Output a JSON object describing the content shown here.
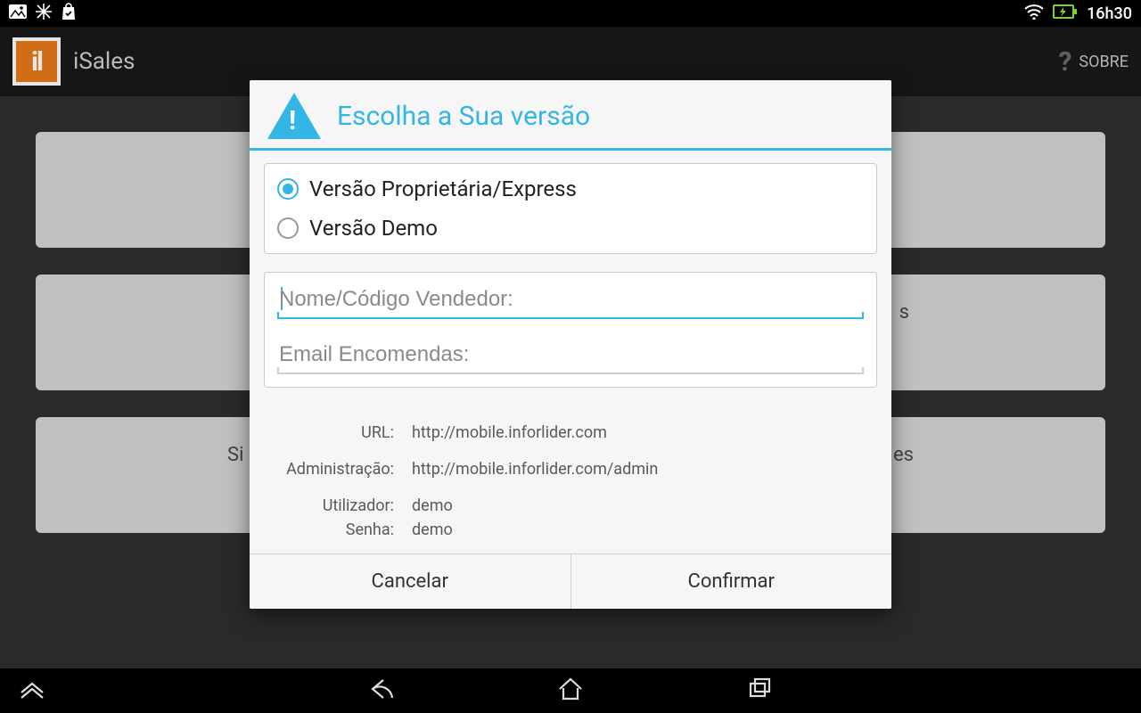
{
  "status": {
    "time": "16h30"
  },
  "actionbar": {
    "title": "iSales",
    "sobre": "SOBRE"
  },
  "background": {
    "text1": "Si",
    "text2": "s",
    "text3": "es"
  },
  "dialog": {
    "title": "Escolha a Sua versão",
    "options": {
      "proprietary": "Versão Proprietária/Express",
      "demo": "Versão Demo"
    },
    "inputs": {
      "vendor_placeholder": "Nome/Código Vendedor:",
      "email_placeholder": "Email Encomendas:"
    },
    "info": {
      "url_label": "URL:",
      "url_value": "http://mobile.inforlider.com",
      "admin_label": "Administração:",
      "admin_value": "http://mobile.inforlider.com/admin",
      "user_label": "Utilizador:",
      "user_value": "demo",
      "password_label": "Senha:",
      "password_value": "demo"
    },
    "buttons": {
      "cancel": "Cancelar",
      "confirm": "Confirmar"
    }
  }
}
